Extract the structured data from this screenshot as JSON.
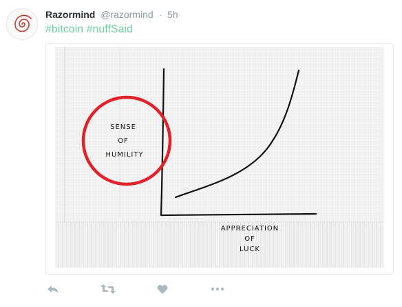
{
  "tweet": {
    "author_name": "Razormind",
    "author_handle": "@razormind",
    "separator": "·",
    "time": "5h",
    "hashtags": [
      "#bitcoin",
      "#nuffSaid"
    ]
  },
  "napkin": {
    "circled_label": [
      "SENSE",
      "OF",
      "HUMILITY"
    ],
    "x_axis_label": [
      "APPRECIATION",
      "OF",
      "LUCK"
    ]
  },
  "colors": {
    "hashtag": "#6fd0a3",
    "circle": "#e0232b",
    "icon": "#aab8c2"
  },
  "actions": [
    "reply-icon",
    "retweet-icon",
    "like-icon",
    "more-icon"
  ]
}
